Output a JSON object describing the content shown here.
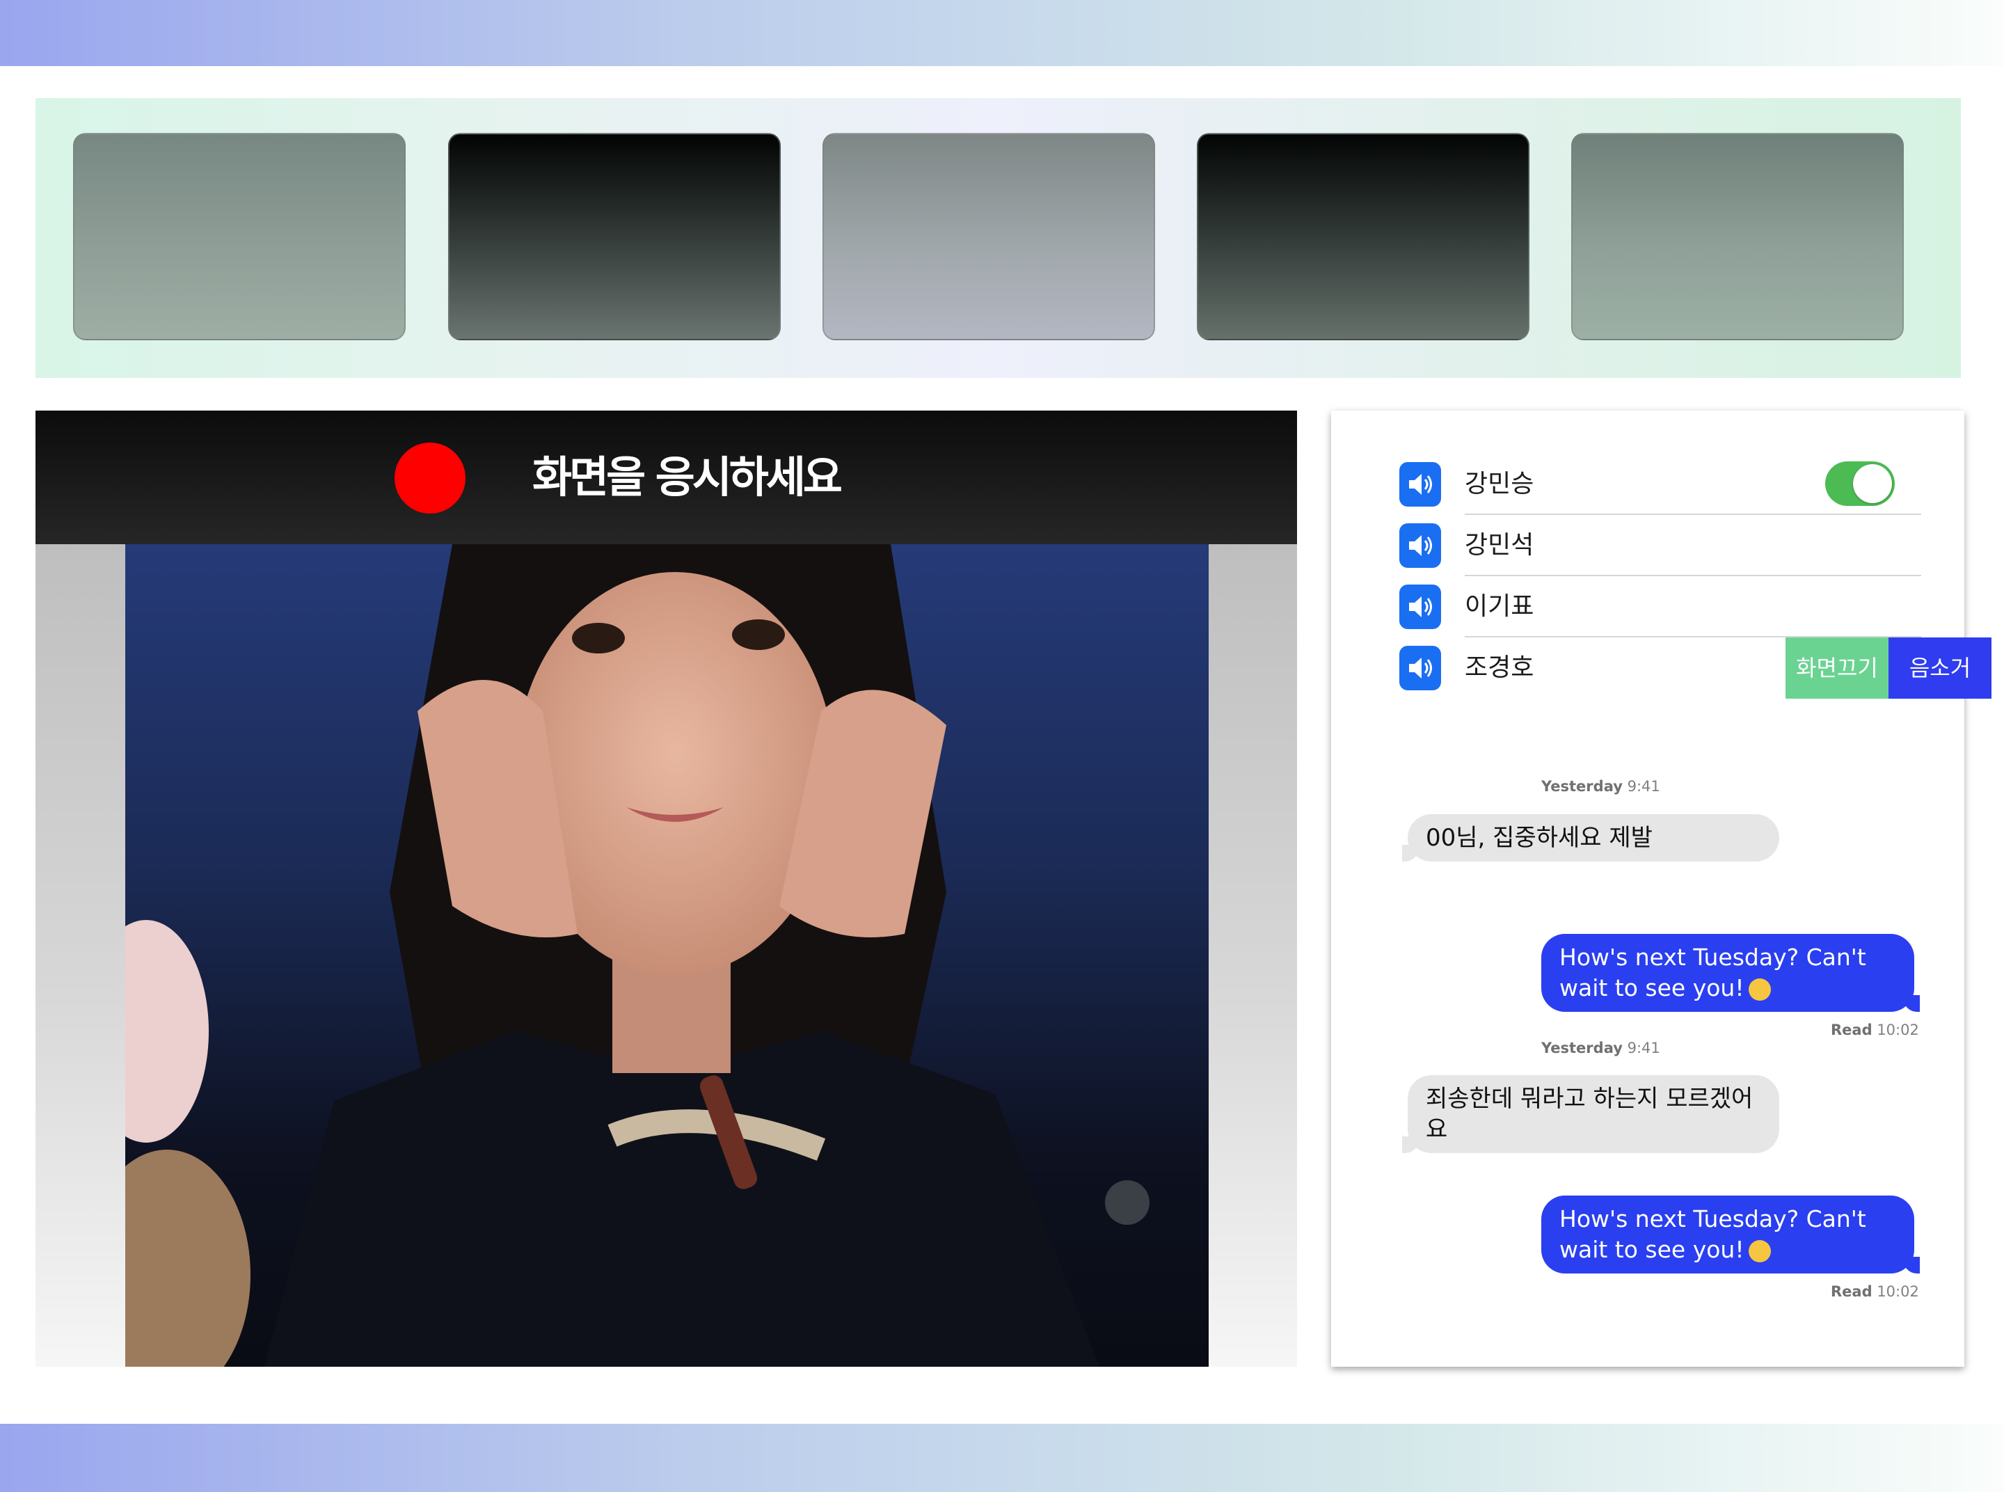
{
  "video": {
    "title": "화면을 응시하세요",
    "recording_icon": "record-dot-icon"
  },
  "thumbnails": [
    {
      "label": ""
    },
    {
      "label": ""
    },
    {
      "label": ""
    },
    {
      "label": ""
    },
    {
      "label": ""
    }
  ],
  "participants": [
    {
      "name": "강민승",
      "icon": "speaker-icon",
      "toggle_on": true
    },
    {
      "name": "강민석",
      "icon": "speaker-icon"
    },
    {
      "name": "이기표",
      "icon": "speaker-icon"
    },
    {
      "name": "조경호",
      "icon": "speaker-icon",
      "actions": [
        "화면끄기",
        "음소거"
      ]
    }
  ],
  "colors": {
    "accent_blue": "#2a3ff0",
    "toggle_green": "#4cbb54",
    "record_red": "#ff0000",
    "action_green": "#6bd392"
  },
  "chat": {
    "messages": [
      {
        "timestamp_day": "Yesterday",
        "timestamp_time": "9:41",
        "direction": "in",
        "text": "00님, 집중하세요 제발"
      },
      {
        "direction": "out",
        "text": "How's next Tuesday? Can't wait to see you!",
        "emoji": "hugging-face",
        "read_label": "Read",
        "read_time": "10:02"
      },
      {
        "timestamp_day": "Yesterday",
        "timestamp_time": "9:41",
        "direction": "in",
        "text": "죄송한데 뭐라고 하는지 모르겠어요"
      },
      {
        "direction": "out",
        "text": "How's next Tuesday? Can't wait to see you!",
        "emoji": "hugging-face",
        "read_label": "Read",
        "read_time": "10:02"
      }
    ]
  }
}
